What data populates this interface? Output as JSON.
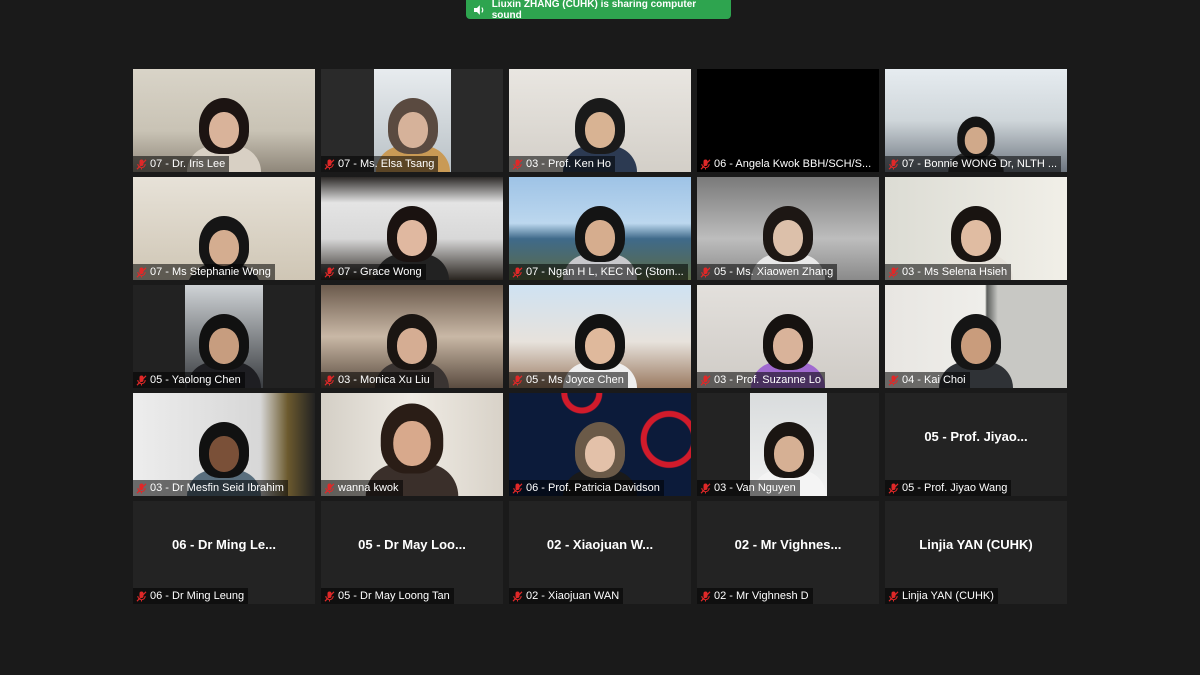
{
  "banner": {
    "text": "Liuxin ZHANG (CUHK) is sharing computer sound",
    "icon": "speaker-icon",
    "color": "#2ea44f"
  },
  "colors": {
    "background": "#1a1a1a",
    "tile_empty": "#232323",
    "mic_muted": "#e02828"
  },
  "participants": [
    {
      "label": "07 - Dr. Iris Lee",
      "video": true
    },
    {
      "label": "07 - Ms. Elsa Tsang",
      "video": true
    },
    {
      "label": "03 - Prof. Ken Ho",
      "video": true
    },
    {
      "label": "06 - Angela Kwok BBH/SCH/S...",
      "video": false
    },
    {
      "label": "07 - Bonnie WONG Dr, NLTH ...",
      "video": true
    },
    {
      "label": "07 - Ms Stephanie Wong",
      "video": true
    },
    {
      "label": "07 - Grace Wong",
      "video": true
    },
    {
      "label": "07 - Ngan H L, KEC NC (Stom...",
      "video": true
    },
    {
      "label": "05 - Ms. Xiaowen Zhang",
      "video": true
    },
    {
      "label": "03 - Ms Selena Hsieh",
      "video": true
    },
    {
      "label": "05 - Yaolong Chen",
      "video": true
    },
    {
      "label": "03 - Monica Xu Liu",
      "video": true
    },
    {
      "label": "05 - Ms Joyce Chen",
      "video": true
    },
    {
      "label": "03 - Prof. Suzanne Lo",
      "video": true
    },
    {
      "label": "04 - Kai Choi",
      "video": true
    },
    {
      "label": "03 - Dr Mesfin Seid Ibrahim",
      "video": true
    },
    {
      "label": "wanna kwok",
      "video": true
    },
    {
      "label": "06 - Prof. Patricia Davidson",
      "video": true
    },
    {
      "label": "03 - Van Nguyen",
      "video": true
    },
    {
      "label": "05 - Prof. Jiyao Wang",
      "video": false,
      "display_name": "05 - Prof. Jiyao..."
    },
    {
      "label": "06 - Dr Ming Leung",
      "video": false,
      "display_name": "06 - Dr Ming Le..."
    },
    {
      "label": "05 - Dr May Loong Tan",
      "video": false,
      "display_name": "05 - Dr May Loo..."
    },
    {
      "label": "02 - Xiaojuan WAN",
      "video": false,
      "display_name": "02 - Xiaojuan W..."
    },
    {
      "label": "02 - Mr Vighnesh D",
      "video": false,
      "display_name": "02 - Mr Vighnes..."
    },
    {
      "label": "Linjia YAN (CUHK)",
      "video": false,
      "display_name": "Linjia YAN (CUHK)"
    }
  ]
}
